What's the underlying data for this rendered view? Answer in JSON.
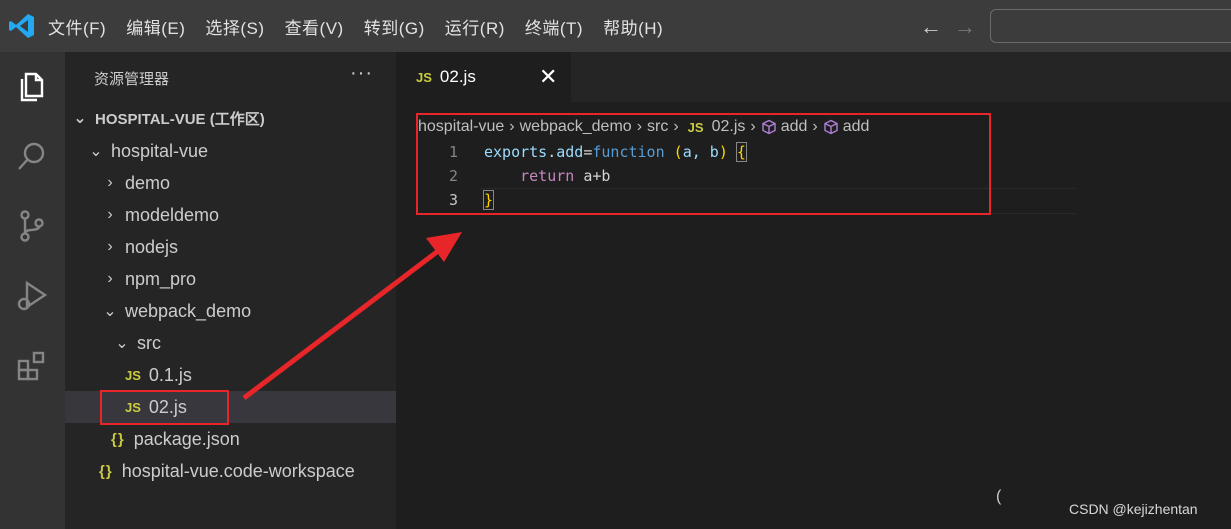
{
  "menu": [
    "文件(F)",
    "编辑(E)",
    "选择(S)",
    "查看(V)",
    "转到(G)",
    "运行(R)",
    "终端(T)",
    "帮助(H)"
  ],
  "nav": {
    "back": "←",
    "forward": "→"
  },
  "sidebar": {
    "title": "资源管理器",
    "more": "···",
    "workspace": "HOSPITAL-VUE (工作区)",
    "tree": [
      {
        "label": "hospital-vue",
        "kind": "folder",
        "expanded": true
      },
      {
        "label": "demo",
        "kind": "folder",
        "expanded": false
      },
      {
        "label": "modeldemo",
        "kind": "folder",
        "expanded": false
      },
      {
        "label": "nodejs",
        "kind": "folder",
        "expanded": false
      },
      {
        "label": "npm_pro",
        "kind": "folder",
        "expanded": false
      },
      {
        "label": "webpack_demo",
        "kind": "folder",
        "expanded": true
      },
      {
        "label": "src",
        "kind": "folder",
        "expanded": true
      },
      {
        "label": "0.1.js",
        "kind": "js"
      },
      {
        "label": "02.js",
        "kind": "js",
        "selected": true
      },
      {
        "label": "package.json",
        "kind": "json"
      },
      {
        "label": "hospital-vue.code-workspace",
        "kind": "json"
      }
    ],
    "js_badge": "JS",
    "json_badge": "{}"
  },
  "editor": {
    "tab": {
      "badge": "JS",
      "label": "02.js",
      "close": "✕"
    },
    "breadcrumb": [
      "hospital-vue",
      "webpack_demo",
      "src",
      "02.js",
      "add",
      "add"
    ],
    "lines": [
      {
        "num": "1",
        "tokens": [
          "exports",
          ".",
          "add",
          "=",
          "function",
          " (",
          "a, b",
          ") ",
          "{"
        ]
      },
      {
        "num": "2",
        "tokens": [
          "    ",
          "return",
          " a+b"
        ]
      },
      {
        "num": "3",
        "tokens": [
          "}"
        ]
      }
    ],
    "cursor_char": "("
  },
  "colors": {
    "accent_red": "#e8262a",
    "js_yellow": "#cbcb41",
    "vscode_blue": "#23a9f2"
  },
  "watermark": "CSDN @kejizhentan"
}
